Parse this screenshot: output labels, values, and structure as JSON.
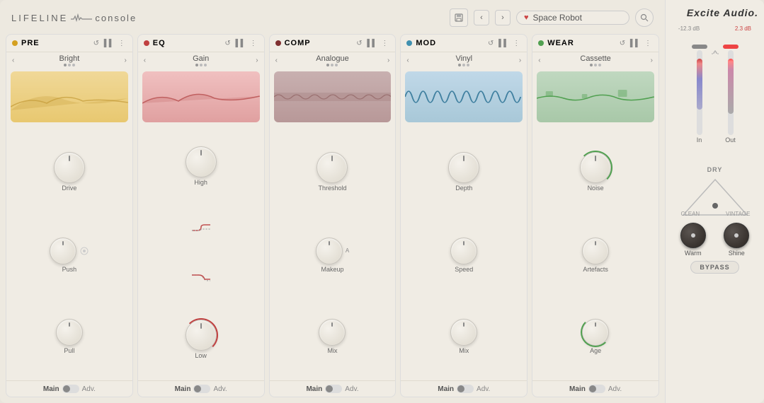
{
  "app": {
    "title": "LIFELINE console",
    "logo_wave": "~"
  },
  "topbar": {
    "save_label": "💾",
    "back_label": "‹",
    "forward_label": "›",
    "preset_name": "Space Robot",
    "search_label": "🔍"
  },
  "modules": [
    {
      "id": "pre",
      "name": "PRE",
      "dot_color": "#d4a020",
      "preset": "Bright",
      "knobs": [
        {
          "label": "Drive"
        },
        {
          "label": "Push"
        },
        {
          "label": "Pull"
        }
      ],
      "wf_class": "wf-pre"
    },
    {
      "id": "eq",
      "name": "EQ",
      "dot_color": "#c04040",
      "preset": "Gain",
      "knobs": [
        {
          "label": "High"
        },
        {
          "label": "Low"
        }
      ],
      "wf_class": "wf-eq",
      "has_filters": true
    },
    {
      "id": "comp",
      "name": "COMP",
      "dot_color": "#803030",
      "preset": "Analogue",
      "knobs": [
        {
          "label": "Threshold"
        },
        {
          "label": "Makeup"
        },
        {
          "label": "Mix"
        }
      ],
      "wf_class": "wf-comp"
    },
    {
      "id": "mod",
      "name": "MOD",
      "dot_color": "#4090b0",
      "preset": "Vinyl",
      "knobs": [
        {
          "label": "Depth"
        },
        {
          "label": "Speed"
        },
        {
          "label": "Mix"
        }
      ],
      "wf_class": "wf-mod"
    },
    {
      "id": "wear",
      "name": "WEAR",
      "dot_color": "#50a050",
      "preset": "Cassette",
      "knobs": [
        {
          "label": "Noise"
        },
        {
          "label": "Artefacts"
        },
        {
          "label": "Age"
        }
      ],
      "wf_class": "wf-wear"
    }
  ],
  "right_panel": {
    "brand": "Excite Audio.",
    "meter_in_db": "-12.3 dB",
    "meter_out_db": "2.3 dB",
    "in_label": "In",
    "out_label": "Out",
    "dry_label": "DRY",
    "clean_label": "CLEAN",
    "vintage_label": "VINTAGE",
    "warm_label": "Warm",
    "shine_label": "Shine",
    "bypass_label": "BYPASS"
  }
}
